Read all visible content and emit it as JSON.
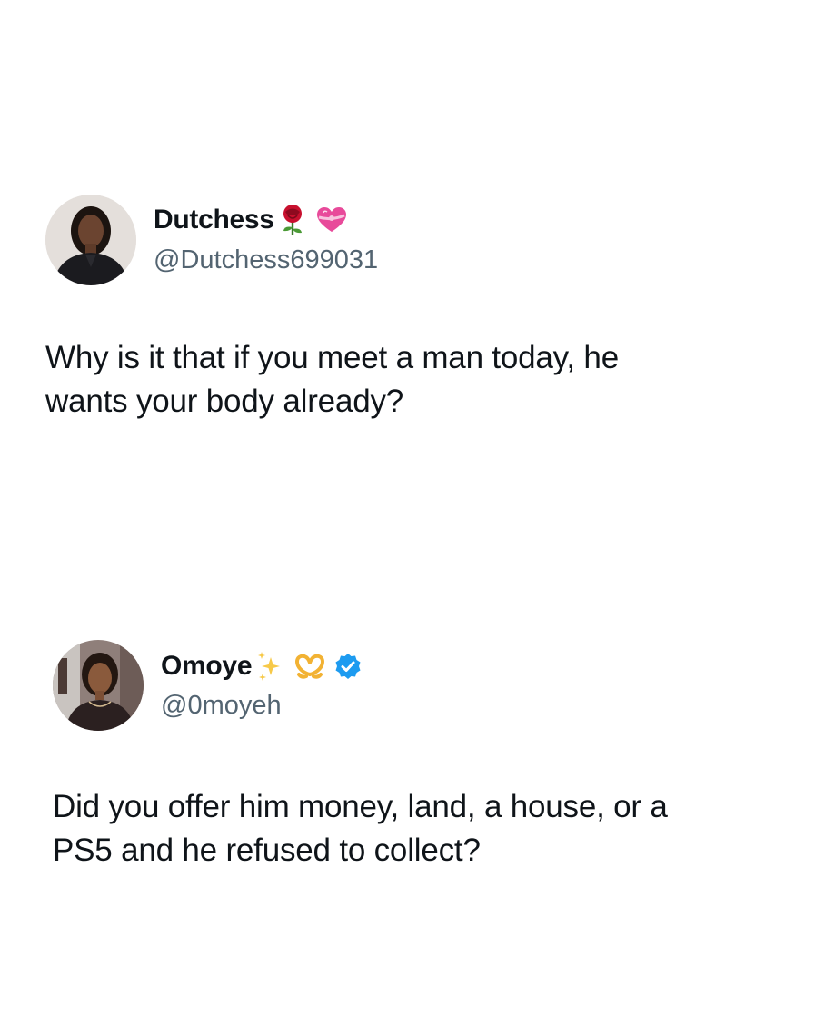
{
  "tweets": [
    {
      "display_name": "Dutchess",
      "name_emojis": [
        "rose-emoji",
        "heart-with-ribbon-emoji"
      ],
      "handle": "@Dutchess699031",
      "text_lines": [
        "Why is it that if you meet a man today, he",
        "wants your body already?"
      ]
    },
    {
      "display_name": "Omoye",
      "name_emojis": [
        "sparkles-emoji",
        "heart-hands-emoji",
        "verified-badge-icon"
      ],
      "handle": "@0moyeh",
      "text_lines": [
        "Did you offer him money, land, a house, or a",
        "PS5 and he refused to collect?"
      ]
    }
  ],
  "colors": {
    "background": "#ffffff",
    "text_primary": "#0f1419",
    "text_secondary": "#536471",
    "verified_blue": "#1d9bf0"
  }
}
